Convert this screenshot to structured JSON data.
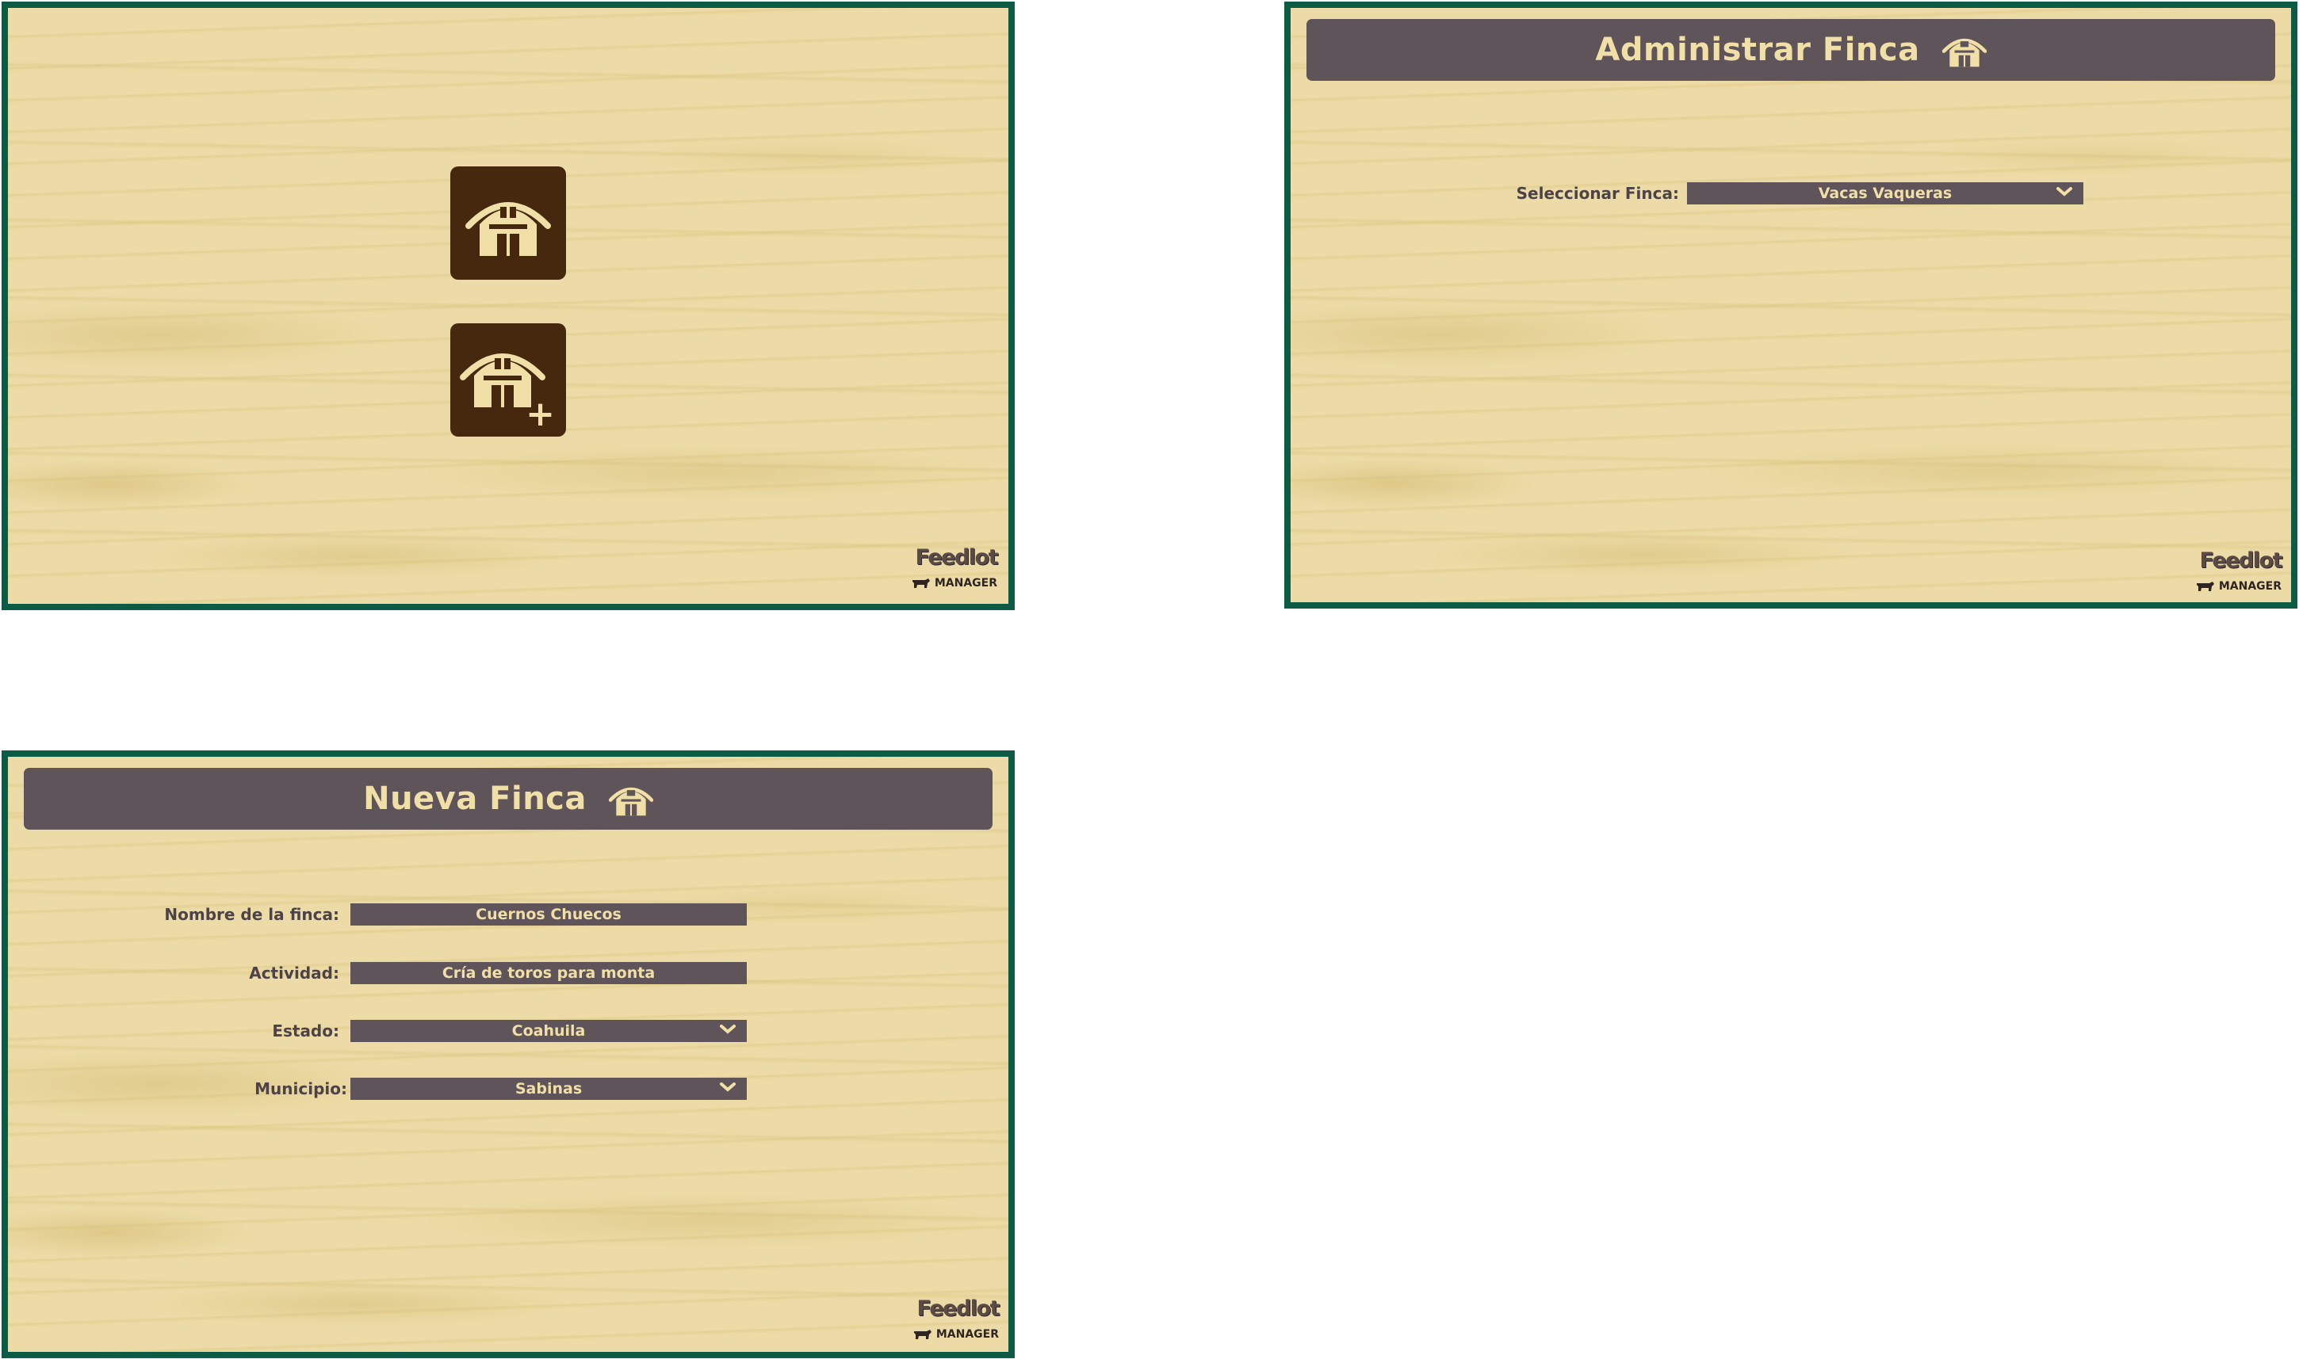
{
  "home": {
    "manage_button": {
      "icon": "barn-icon",
      "tooltip": ""
    },
    "new_button": {
      "icon": "barn-add-icon",
      "plus_glyph": "+"
    }
  },
  "admin": {
    "title": "Administrar Finca",
    "title_icon": "barn-icon",
    "select_label": "Seleccionar Finca:",
    "select_value": "Vacas Vaqueras"
  },
  "new_farm": {
    "title": "Nueva Finca",
    "title_icon": "barn-icon",
    "fields": {
      "name_label": "Nombre de la finca:",
      "name_value": "Cuernos Chuecos",
      "activity_label": "Actividad:",
      "activity_value": "Cría de toros para monta",
      "state_label": "Estado:",
      "state_value": "Coahuila",
      "municipality_label": "Municipio:",
      "municipality_value": "Sabinas"
    }
  },
  "logo": {
    "word": "Feedlot",
    "sub": "MANAGER"
  },
  "colors": {
    "frame": "#0b5b45",
    "background": "#ecdba6",
    "bar": "#5f5459",
    "button": "#45280e",
    "accent_text": "#f0dfa6"
  }
}
